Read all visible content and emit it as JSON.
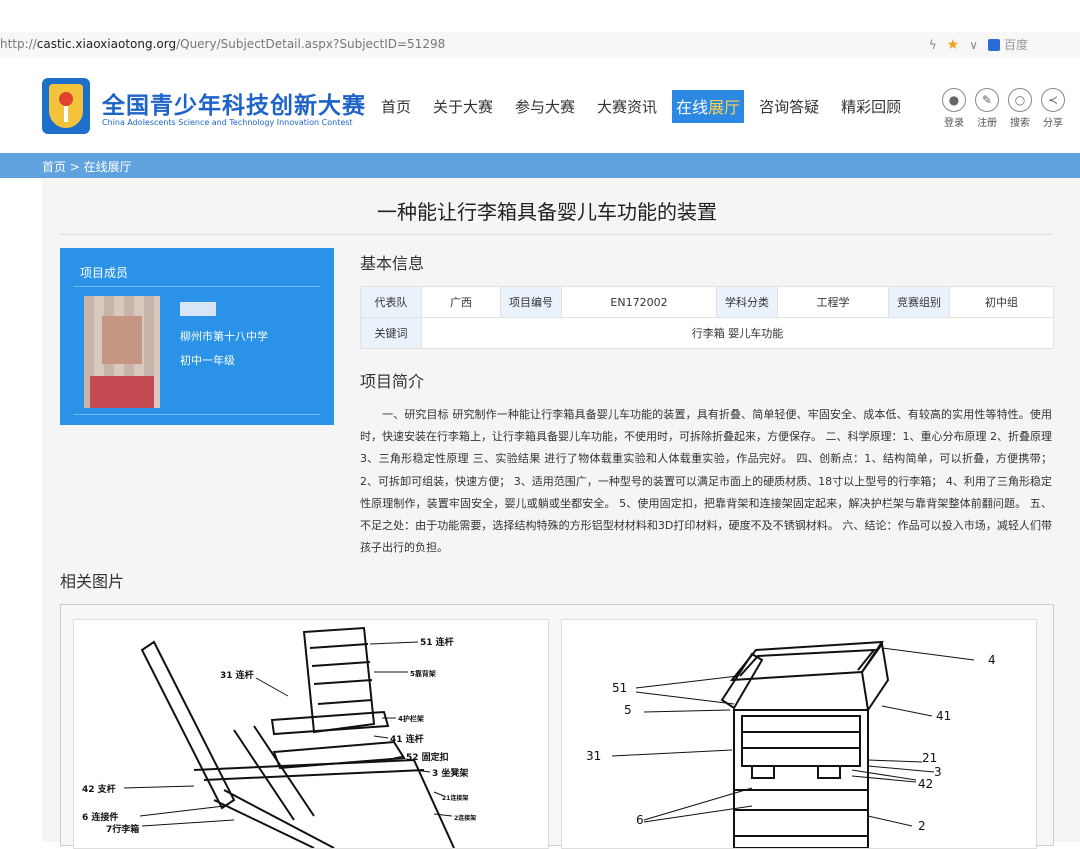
{
  "browser": {
    "url_prefix": "http://",
    "url_domain": "castic.xiaoxiaotong.org",
    "url_path": "/Query/SubjectDetail.aspx?SubjectID=51298",
    "search_engine_label": "百度"
  },
  "header": {
    "brand_cn": "全国青少年科技创新大赛",
    "brand_en": "China Adolescents Science and Technology Innovation Contest",
    "nav": [
      "首页",
      "关于大赛",
      "参与大赛",
      "大赛资讯",
      "咨询答疑",
      "精彩回顾"
    ],
    "active_nav_a": "在线",
    "active_nav_b": "展厅",
    "tools": {
      "login": "登录",
      "register": "注册",
      "search": "搜索",
      "share": "分享"
    }
  },
  "breadcrumb": "首页 > 在线展厅",
  "project": {
    "title": "一种能让行李箱具备婴儿车功能的装置",
    "member_header": "项目成员",
    "school": "柳州市第十八中学",
    "grade": "初中一年级",
    "basic_info_title": "基本信息",
    "info": {
      "team_label": "代表队",
      "team": "广西",
      "code_label": "项目编号",
      "code": "EN172002",
      "subject_label": "学科分类",
      "subject": "工程学",
      "group_label": "竞赛组别",
      "group": "初中组",
      "keywords_label": "关键词",
      "keywords": "行李箱 婴儿车功能"
    },
    "intro_title": "项目简介",
    "intro": "一、研究目标 研究制作一种能让行李箱具备婴儿车功能的装置，具有折叠、简单轻便、牢固安全、成本低、有较高的实用性等特性。使用时，快速安装在行李箱上，让行李箱具备婴儿车功能，不使用时，可拆除折叠起来，方便保存。 二、科学原理：1、重心分布原理 2、折叠原理 3、三角形稳定性原理 三、实验结果 进行了物体载重实验和人体载重实验，作品完好。 四、创新点：1、结构简单，可以折叠，方便携带； 2、可拆卸可组装，快速方便； 3、适用范围广，一种型号的装置可以满足市面上的硬质材质、18寸以上型号的行李箱； 4、利用了三角形稳定性原理制作，装置牢固安全，婴儿或躺或坐都安全。 5、使用固定扣，把靠背架和连接架固定起来，解决护栏架与靠背架整体前翻问题。 五、不足之处：由于功能需要，选择结构特殊的方形铝型材材料和3D打印材料，硬度不及不锈钢材料。 六、结论：作品可以投入市场，减轻人们带孩子出行的负担。",
    "related_title": "相关图片",
    "fig1_labels": [
      "51 连杆",
      "5靠背架",
      "31 连杆",
      "4护栏架",
      "41 连杆",
      "52 固定扣",
      "3 坐凳架",
      "21连接架",
      "2连接架",
      "42 支杆",
      "6 连接件",
      "7行李箱"
    ],
    "fig2_labels": [
      "4",
      "51",
      "5",
      "41",
      "31",
      "21",
      "3",
      "42",
      "6",
      "2"
    ]
  }
}
